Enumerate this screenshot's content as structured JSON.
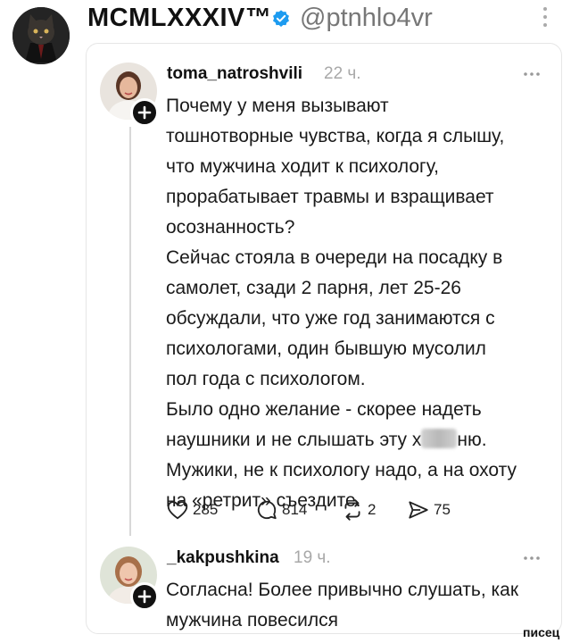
{
  "header": {
    "display_name": "MCMLXXXIV™",
    "handle": "@ptnhlo4vr"
  },
  "post": {
    "username": "toma_natroshvili",
    "time": "22 ч.",
    "lines": [
      "Почему у меня вызывают",
      "тошнотворные чувства, когда я слышу,",
      "что мужчина ходит к психологу,",
      "прорабатывает травмы и взращивает",
      "осознанность?",
      "Сейчас стояла в очереди на посадку в",
      "самолет, сзади 2 парня, лет 25-26",
      "обсуждали, что уже год занимаются с",
      "психологами, один бывшую мусолил",
      "пол года с психологом.",
      "Было одно желание - скорее надеть"
    ],
    "censored_line_start": "наушники и не слышать эту х",
    "censored_line_end": "ню.",
    "last_lines": [
      "Мужики, не к психологу надо, а на охоту",
      "на «ретрит» съездите."
    ],
    "actions": {
      "likes": "285",
      "comments": "814",
      "reposts": "2",
      "shares": "75"
    }
  },
  "reply": {
    "username": "_kakpushkina",
    "time": "19 ч.",
    "lines": [
      "Согласна! Более привычно слушать, как",
      "мужчина повесился"
    ]
  },
  "watermark": "писец",
  "colors": {
    "verified_blue": "#1d9bf0",
    "muted_text": "#a8a8a8"
  },
  "icons": [
    "cat-avatar",
    "verified-badge-icon",
    "more-vertical-icon",
    "more-horizontal-icon",
    "heart-icon",
    "comment-icon",
    "repost-icon",
    "share-icon",
    "plus-icon"
  ]
}
